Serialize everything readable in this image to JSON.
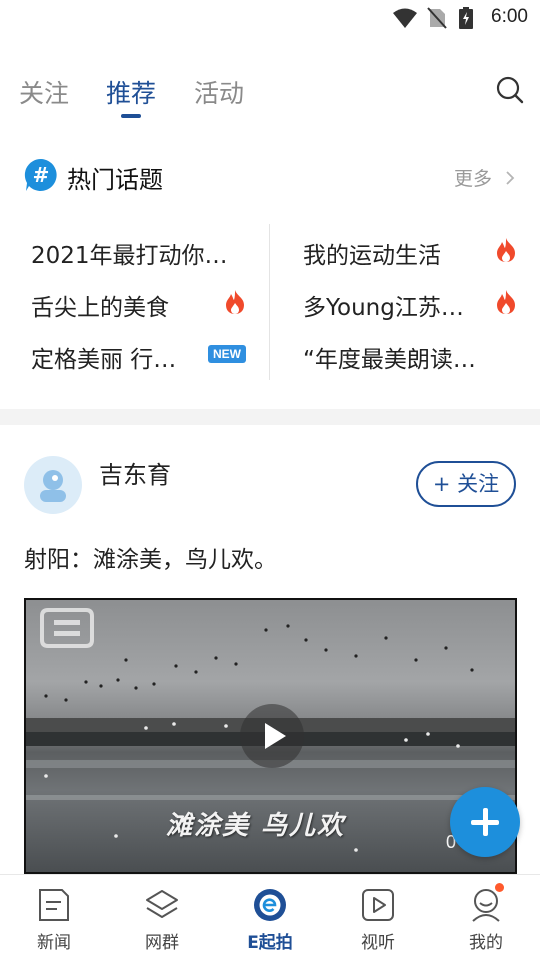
{
  "status_bar": {
    "time": "6:00",
    "icons": [
      "wifi-icon",
      "no-sim-icon",
      "battery-charging-icon"
    ]
  },
  "top_tabs": {
    "items": [
      {
        "label": "关注",
        "active": false
      },
      {
        "label": "推荐",
        "active": true
      },
      {
        "label": "活动",
        "active": false
      }
    ],
    "search_icon": "search-icon"
  },
  "hot_topics": {
    "title": "热门话题",
    "more_label": "更多",
    "left": [
      {
        "text": "2021年最打动你…",
        "badge": ""
      },
      {
        "text": "舌尖上的美食",
        "badge": "fire"
      },
      {
        "text": "定格美丽 行…",
        "badge": "NEW"
      }
    ],
    "right": [
      {
        "text": "我的运动生活",
        "badge": "fire"
      },
      {
        "text": "多Young江苏…",
        "badge": "fire"
      },
      {
        "text": "“年度最美朗读…",
        "badge": ""
      }
    ]
  },
  "post": {
    "author": "吉东育",
    "follow_label": "+ 关注",
    "text": "射阳：滩涂美，鸟儿欢。",
    "video": {
      "overlay_text": "滩涂美  鸟儿欢",
      "time_text": "0"
    }
  },
  "bottom_nav": {
    "items": [
      {
        "label": "新闻",
        "icon": "news-icon",
        "active": false
      },
      {
        "label": "网群",
        "icon": "layers-icon",
        "active": false
      },
      {
        "label": "E起拍",
        "icon": "e-shoot-icon",
        "active": true
      },
      {
        "label": "视听",
        "icon": "play-box-icon",
        "active": false
      },
      {
        "label": "我的",
        "icon": "profile-icon",
        "active": false,
        "dot": true
      }
    ]
  },
  "colors": {
    "accent": "#1f4f96",
    "fab": "#1d8fdc",
    "fire": "#f04a2c",
    "new_badge": "#2f8fe0"
  }
}
